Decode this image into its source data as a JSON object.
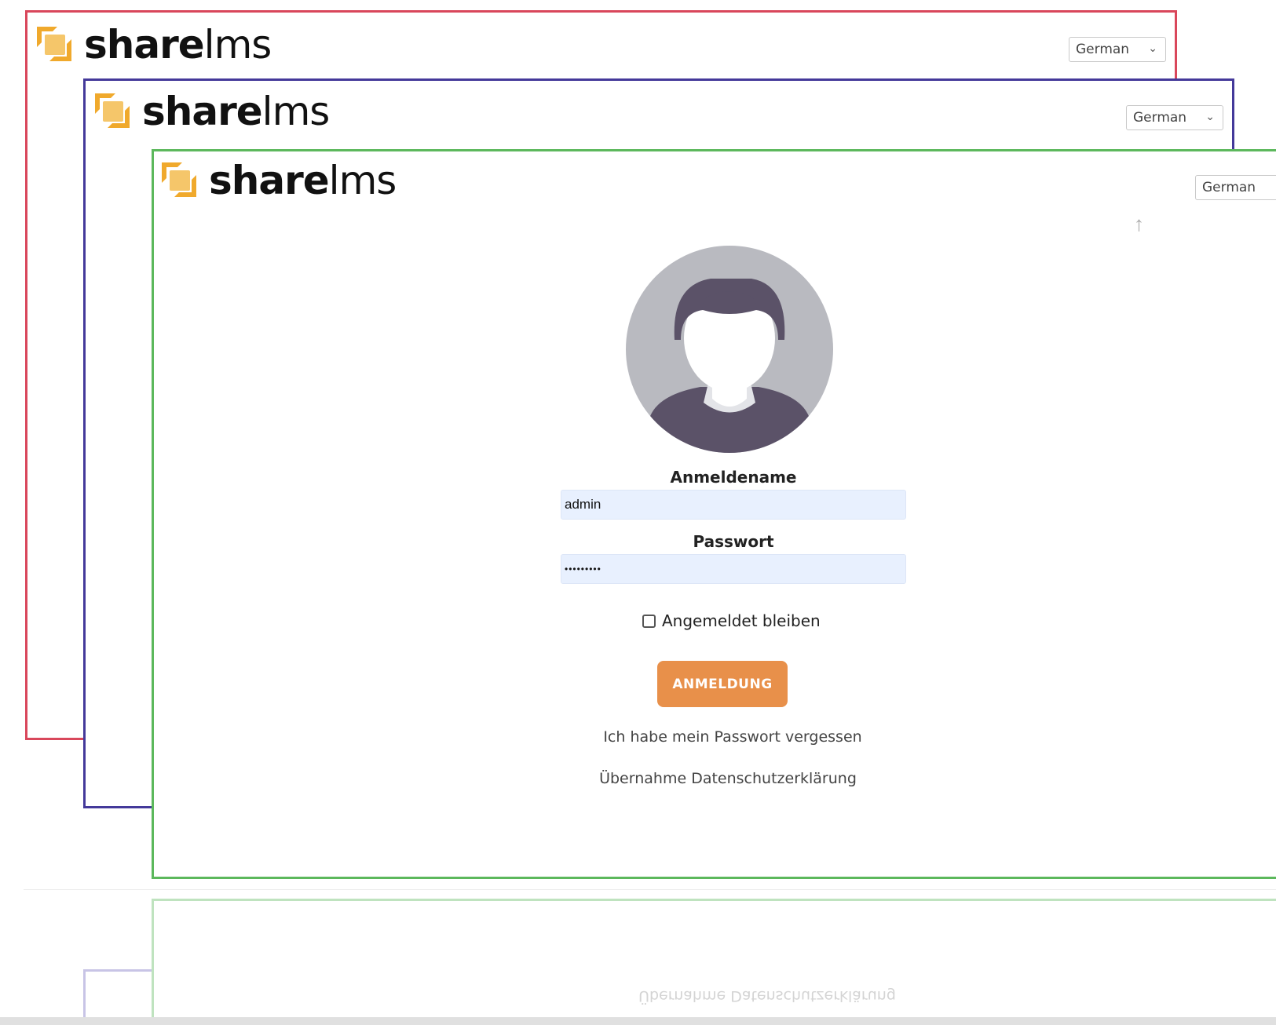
{
  "brand": {
    "name_bold": "share",
    "name_light": "lms",
    "accent_color": "#f0a92c"
  },
  "language_select": {
    "value": "German"
  },
  "login": {
    "username_label": "Anmeldename",
    "username_value": "admin",
    "password_label": "Passwort",
    "password_value": "•••••••••",
    "remember_label": "Angemeldet bleiben",
    "submit_label": "ANMELDUNG",
    "button_color": "#e8904a",
    "forgot_link": "Ich habe mein Passwort vergessen",
    "privacy_link": "Übernahme Datenschutzerklärung"
  },
  "frames": {
    "red": "#d9475b",
    "blue": "#44399a",
    "green": "#5cb85c"
  },
  "icons": {
    "logo": "sharelms-logo-icon",
    "avatar": "user-avatar-icon",
    "scroll": "up-arrow-icon",
    "dropdown": "chevron-down-icon"
  }
}
